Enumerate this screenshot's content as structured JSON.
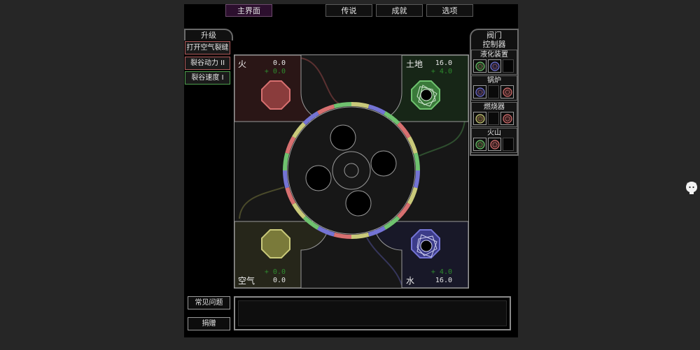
{
  "tabs": {
    "main": "主界面",
    "legend": "传说",
    "achievements": "成就",
    "options": "选项"
  },
  "upgrades": {
    "title": "升级",
    "items": [
      "打开空气裂缝",
      "裂谷动力 II",
      "裂谷速度 I"
    ]
  },
  "valves": {
    "title": "阀门\n控制器",
    "title_line1": "阀门",
    "title_line2": "控制器",
    "items": [
      {
        "label": "液化装置",
        "inputs": [
          "earth",
          "water"
        ]
      },
      {
        "label": "锅炉",
        "inputs": [
          "water",
          "fire"
        ]
      },
      {
        "label": "燃烧器",
        "inputs": [
          "air",
          "fire"
        ]
      },
      {
        "label": "火山",
        "inputs": [
          "earth",
          "fire"
        ]
      }
    ]
  },
  "elements": {
    "fire": {
      "name": "火",
      "amount": "0.0",
      "rate": "+ 0.0"
    },
    "earth": {
      "name": "土地",
      "amount": "16.0",
      "rate": "+ 4.0"
    },
    "air": {
      "name": "空气",
      "amount": "0.0",
      "rate": "+ 0.0"
    },
    "water": {
      "name": "水",
      "amount": "16.0",
      "rate": "+ 4.0"
    }
  },
  "colors": {
    "fire": "#d77070",
    "earth": "#6fc26f",
    "air": "#c9c97a",
    "water": "#7474d4",
    "fire_bg": "#2a1616",
    "earth_bg": "#172617",
    "air_bg": "#26261a",
    "water_bg": "#181828"
  },
  "footer": {
    "faq": "常见问题",
    "donate": "捐赠"
  },
  "icons": {
    "github": "github-cat-icon"
  }
}
